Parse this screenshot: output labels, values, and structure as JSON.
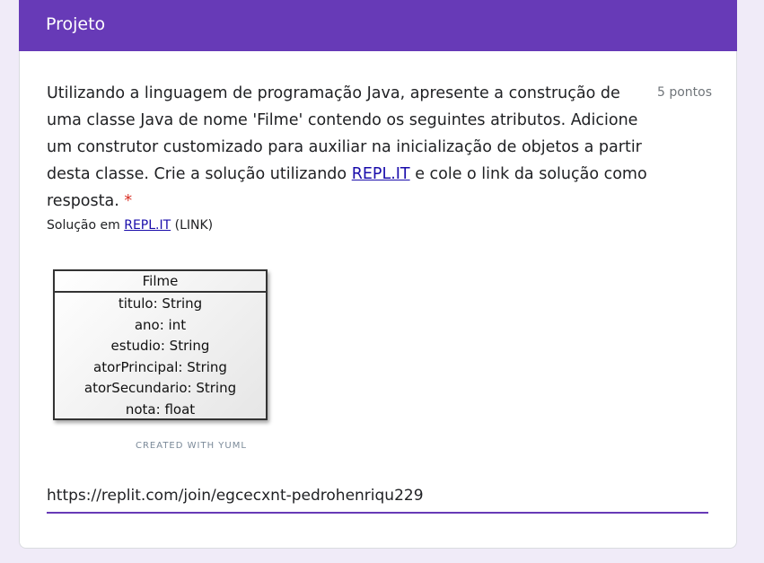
{
  "section": {
    "title": "Projeto"
  },
  "question": {
    "text_part1": "Utilizando a linguagem de programação Java, apresente a construção de uma classe Java de nome 'Filme' contendo os seguintes atributos. Adicione um construtor customizado para auxiliar na inicialização de objetos a partir desta classe. Crie a solução utilizando ",
    "link_text": "REPL.IT",
    "text_part2": " e cole o link da solução como resposta.",
    "required_marker": "*",
    "points": "5 pontos"
  },
  "description": {
    "prefix": "Solução em ",
    "link_text": "REPL.IT",
    "suffix": " (LINK)"
  },
  "uml": {
    "class_name": "Filme",
    "attributes": [
      "titulo: String",
      "ano: int",
      "estudio: String",
      "atorPrincipal: String",
      "atorSecundario: String",
      "nota: float"
    ],
    "credit": "CREATED WITH YUML"
  },
  "answer": {
    "value": "https://replit.com/join/egcecxnt-pedrohenriqu229"
  },
  "colors": {
    "accent": "#673ab7",
    "background": "#f0ebf8",
    "required": "#d93025",
    "link": "#1a0dab"
  }
}
